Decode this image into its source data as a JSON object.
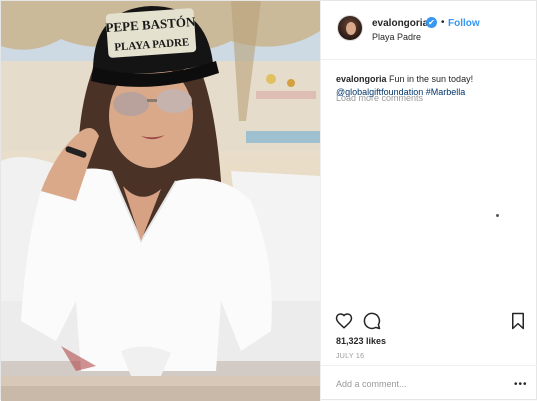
{
  "post": {
    "photo": {
      "hat_text_line1": "PEPE BASTÓN",
      "hat_text_line2": "PLAYA PADRE"
    },
    "header": {
      "username": "evalongoria",
      "verified_glyph": "✔",
      "separator": "•",
      "follow_label": "Follow",
      "location": "Playa Padre"
    },
    "caption": {
      "username": "evalongoria",
      "text": " Fun in the sun today! ",
      "mention": "@globalgiftfoundation",
      "hashtag": " #Marbella"
    },
    "load_more_label": "Load more comments",
    "actions": {
      "like_icon": "heart-icon",
      "comment_icon": "comment-bubble-icon",
      "save_icon": "bookmark-icon"
    },
    "likes_label": "81,323 likes",
    "date_label": "JULY 16",
    "add_comment_placeholder": "Add a comment...",
    "more_options_glyph": "•••"
  }
}
